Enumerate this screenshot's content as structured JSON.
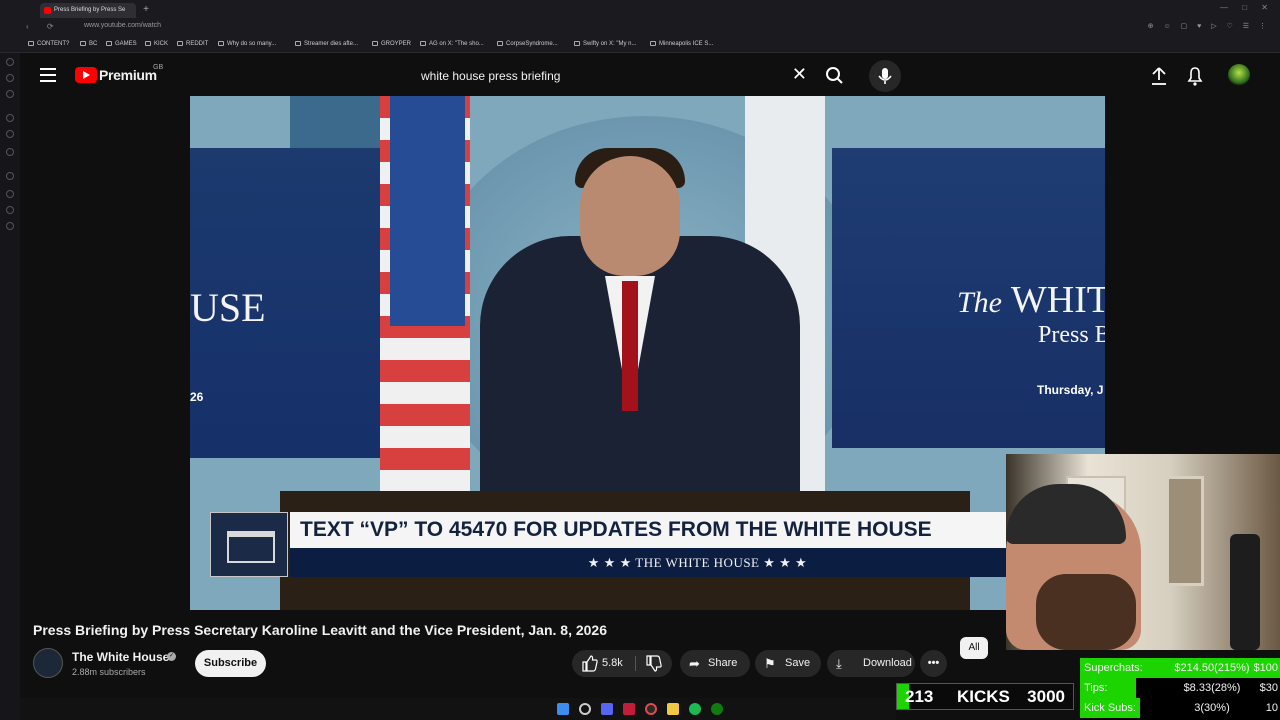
{
  "browser": {
    "tab_title": "Press Briefing by Press Se",
    "new_tab": "+",
    "url": "www.youtube.com/watch",
    "window_controls": "— □ ✕",
    "bookmarks": [
      "CONTENT?",
      "BC",
      "GAMES",
      "KICK",
      "REDDIT",
      "Why do so many...",
      "Streamer dies afte...",
      "GROYPER",
      "AG on X: \"The sho...",
      "CorpseSyndrome...",
      "Swifty on X: \"My n...",
      "Minneapolis ICE S..."
    ]
  },
  "header": {
    "logo_text": "Premium",
    "country_code": "GB",
    "search_value": "white house press briefing",
    "icons": [
      "menu-icon",
      "search-icon",
      "mic-icon",
      "upload-icon",
      "bell-icon"
    ]
  },
  "video": {
    "left_title": "USE",
    "left_date": "26",
    "right_title_italic": "The",
    "right_title": "WHIT",
    "right_subtitle": "Press B",
    "right_date": "Thursday, J",
    "lower_third_text": "TEXT “VP” TO 45470 FOR UPDATES FROM THE WHITE HOUSE",
    "lower_third_sub": "★ ★ ★  THE WHITE HOUSE  ★ ★ ★"
  },
  "watch": {
    "title": "Press Briefing by Press Secretary Karoline Leavitt and the Vice President, Jan. 8, 2026",
    "channel_name": "The White House",
    "subscribers": "2.88m subscribers",
    "subscribe_label": "Subscribe",
    "likes": "5.8k",
    "share_label": "Share",
    "save_label": "Save",
    "download_label": "Download",
    "more_label": "•••",
    "chip_all": "All"
  },
  "stream_overlay": {
    "superchats_label": "Superchats:",
    "superchats_value": "$214.50(215%)",
    "superchats_goal": "$100",
    "superchats_progress": 1.0,
    "tips_label": "Tips:",
    "tips_value": "$8.33(28%)",
    "tips_goal": "$30",
    "tips_progress": 0.28,
    "kicksubs_label": "Kick Subs:",
    "kicksubs_value": "3(30%)",
    "kicksubs_goal": "10",
    "kicksubs_progress": 0.3,
    "kicks_count": "213",
    "kicks_label": "KICKS",
    "kicks_goal": "3000",
    "kicks_progress": 0.07
  },
  "colors": {
    "brand_red": "#ff0000",
    "overlay_green": "#1cd400",
    "background": "#0f0f0f"
  }
}
